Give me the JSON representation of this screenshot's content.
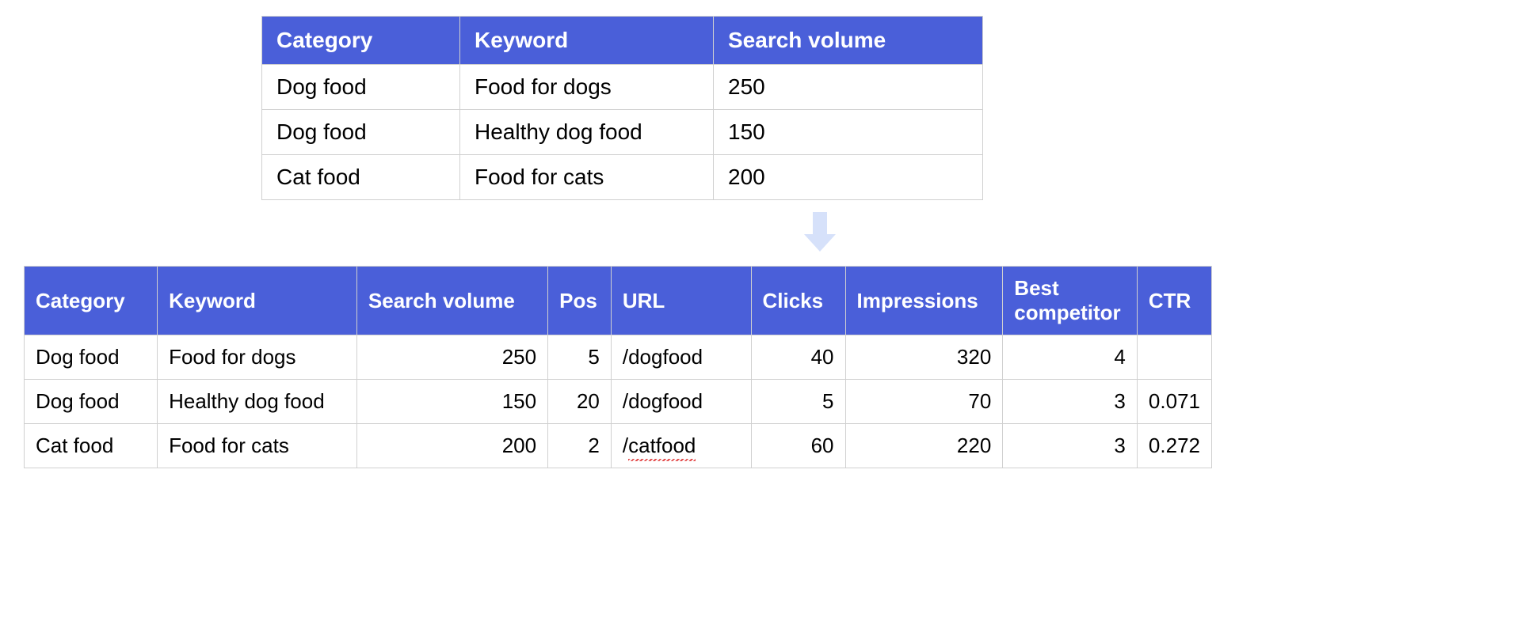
{
  "top_table": {
    "headers": [
      "Category",
      "Keyword",
      "Search volume"
    ],
    "rows": [
      {
        "category": "Dog food",
        "keyword": "Food for dogs",
        "volume": "250"
      },
      {
        "category": "Dog food",
        "keyword": "Healthy dog food",
        "volume": "150"
      },
      {
        "category": "Cat food",
        "keyword": "Food for cats",
        "volume": "200"
      }
    ]
  },
  "bottom_table": {
    "headers": [
      "Category",
      "Keyword",
      "Search volume",
      "Pos",
      "URL",
      "Clicks",
      "Impressions",
      "Best competitor",
      "CTR"
    ],
    "rows": [
      {
        "category": "Dog food",
        "keyword": "Food for dogs",
        "volume": "250",
        "pos": "5",
        "url": "/dogfood",
        "clicks": "40",
        "impressions": "320",
        "best": "4",
        "ctr": ""
      },
      {
        "category": "Dog food",
        "keyword": "Healthy dog food",
        "volume": "150",
        "pos": "20",
        "url": "/dogfood",
        "clicks": "5",
        "impressions": "70",
        "best": "3",
        "ctr": "0.071"
      },
      {
        "category": "Cat food",
        "keyword": "Food for cats",
        "volume": "200",
        "pos": "2",
        "url": "/catfood",
        "clicks": "60",
        "impressions": "220",
        "best": "3",
        "ctr": "0.272"
      }
    ]
  }
}
